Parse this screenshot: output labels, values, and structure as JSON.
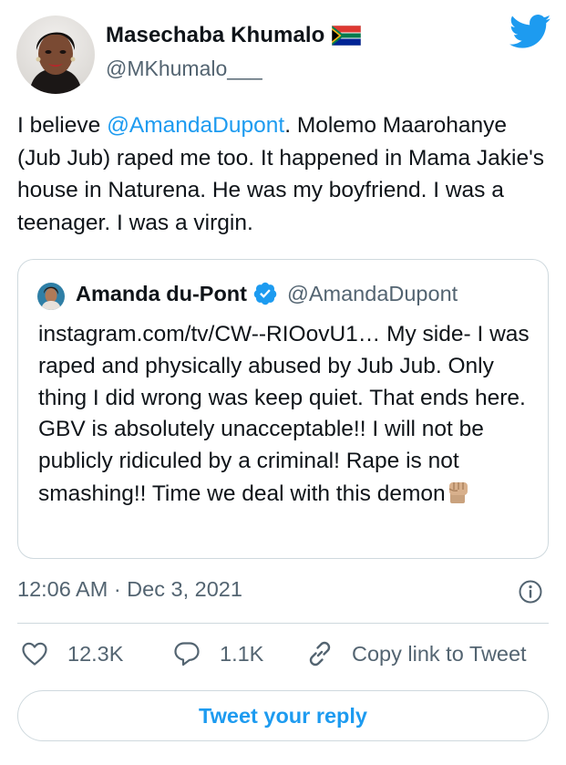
{
  "author": {
    "display_name": "Masechaba Khumalo",
    "flag_icon": "south-africa-flag-icon",
    "handle": "@MKhumalo___"
  },
  "tweet": {
    "text_before_mention": "I believe ",
    "mention": "@AmandaDupont",
    "text_after_mention": ". Molemo Maarohanye (Jub Jub) raped me too. It happened in Mama Jakie's house in Naturena. He was my boyfriend. I was a teenager. I was a virgin."
  },
  "quoted_tweet": {
    "display_name": "Amanda du-Pont",
    "verified_icon": "verified-badge-icon",
    "handle": "@AmandaDupont",
    "text": "instagram.com/tv/CW--RIOovU1… My side- I was raped and physically abused by Jub Jub. Only thing I did wrong was keep quiet. That ends here. GBV is absolutely unacceptable!! I will not be publicly ridiculed by a criminal! Rape is not smashing!! Time we deal with this demon",
    "trailing_emoji": "raised-fist-emoji"
  },
  "meta": {
    "timestamp": "12:06 AM · Dec 3, 2021"
  },
  "actions": {
    "likes": "12.3K",
    "replies": "1.1K",
    "copy_link": "Copy link to Tweet"
  },
  "reply_button": {
    "label": "Tweet your reply"
  },
  "colors": {
    "accent": "#1d9bf0",
    "text": "#0f1419",
    "secondary_text": "#536471",
    "border": "#cfd9de"
  }
}
